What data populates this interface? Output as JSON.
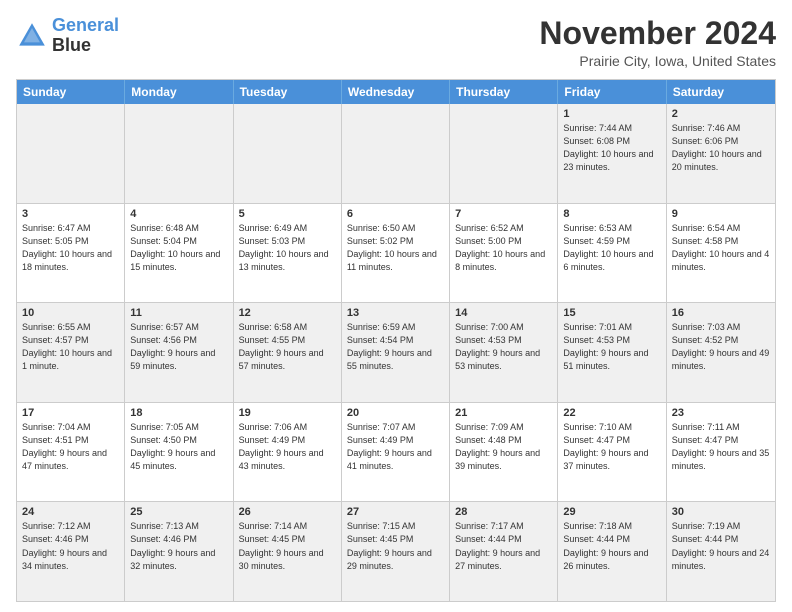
{
  "logo": {
    "line1": "General",
    "line2": "Blue"
  },
  "title": "November 2024",
  "subtitle": "Prairie City, Iowa, United States",
  "days": [
    "Sunday",
    "Monday",
    "Tuesday",
    "Wednesday",
    "Thursday",
    "Friday",
    "Saturday"
  ],
  "rows": [
    [
      {
        "day": "",
        "info": ""
      },
      {
        "day": "",
        "info": ""
      },
      {
        "day": "",
        "info": ""
      },
      {
        "day": "",
        "info": ""
      },
      {
        "day": "",
        "info": ""
      },
      {
        "day": "1",
        "info": "Sunrise: 7:44 AM\nSunset: 6:08 PM\nDaylight: 10 hours and 23 minutes."
      },
      {
        "day": "2",
        "info": "Sunrise: 7:46 AM\nSunset: 6:06 PM\nDaylight: 10 hours and 20 minutes."
      }
    ],
    [
      {
        "day": "3",
        "info": "Sunrise: 6:47 AM\nSunset: 5:05 PM\nDaylight: 10 hours and 18 minutes."
      },
      {
        "day": "4",
        "info": "Sunrise: 6:48 AM\nSunset: 5:04 PM\nDaylight: 10 hours and 15 minutes."
      },
      {
        "day": "5",
        "info": "Sunrise: 6:49 AM\nSunset: 5:03 PM\nDaylight: 10 hours and 13 minutes."
      },
      {
        "day": "6",
        "info": "Sunrise: 6:50 AM\nSunset: 5:02 PM\nDaylight: 10 hours and 11 minutes."
      },
      {
        "day": "7",
        "info": "Sunrise: 6:52 AM\nSunset: 5:00 PM\nDaylight: 10 hours and 8 minutes."
      },
      {
        "day": "8",
        "info": "Sunrise: 6:53 AM\nSunset: 4:59 PM\nDaylight: 10 hours and 6 minutes."
      },
      {
        "day": "9",
        "info": "Sunrise: 6:54 AM\nSunset: 4:58 PM\nDaylight: 10 hours and 4 minutes."
      }
    ],
    [
      {
        "day": "10",
        "info": "Sunrise: 6:55 AM\nSunset: 4:57 PM\nDaylight: 10 hours and 1 minute."
      },
      {
        "day": "11",
        "info": "Sunrise: 6:57 AM\nSunset: 4:56 PM\nDaylight: 9 hours and 59 minutes."
      },
      {
        "day": "12",
        "info": "Sunrise: 6:58 AM\nSunset: 4:55 PM\nDaylight: 9 hours and 57 minutes."
      },
      {
        "day": "13",
        "info": "Sunrise: 6:59 AM\nSunset: 4:54 PM\nDaylight: 9 hours and 55 minutes."
      },
      {
        "day": "14",
        "info": "Sunrise: 7:00 AM\nSunset: 4:53 PM\nDaylight: 9 hours and 53 minutes."
      },
      {
        "day": "15",
        "info": "Sunrise: 7:01 AM\nSunset: 4:53 PM\nDaylight: 9 hours and 51 minutes."
      },
      {
        "day": "16",
        "info": "Sunrise: 7:03 AM\nSunset: 4:52 PM\nDaylight: 9 hours and 49 minutes."
      }
    ],
    [
      {
        "day": "17",
        "info": "Sunrise: 7:04 AM\nSunset: 4:51 PM\nDaylight: 9 hours and 47 minutes."
      },
      {
        "day": "18",
        "info": "Sunrise: 7:05 AM\nSunset: 4:50 PM\nDaylight: 9 hours and 45 minutes."
      },
      {
        "day": "19",
        "info": "Sunrise: 7:06 AM\nSunset: 4:49 PM\nDaylight: 9 hours and 43 minutes."
      },
      {
        "day": "20",
        "info": "Sunrise: 7:07 AM\nSunset: 4:49 PM\nDaylight: 9 hours and 41 minutes."
      },
      {
        "day": "21",
        "info": "Sunrise: 7:09 AM\nSunset: 4:48 PM\nDaylight: 9 hours and 39 minutes."
      },
      {
        "day": "22",
        "info": "Sunrise: 7:10 AM\nSunset: 4:47 PM\nDaylight: 9 hours and 37 minutes."
      },
      {
        "day": "23",
        "info": "Sunrise: 7:11 AM\nSunset: 4:47 PM\nDaylight: 9 hours and 35 minutes."
      }
    ],
    [
      {
        "day": "24",
        "info": "Sunrise: 7:12 AM\nSunset: 4:46 PM\nDaylight: 9 hours and 34 minutes."
      },
      {
        "day": "25",
        "info": "Sunrise: 7:13 AM\nSunset: 4:46 PM\nDaylight: 9 hours and 32 minutes."
      },
      {
        "day": "26",
        "info": "Sunrise: 7:14 AM\nSunset: 4:45 PM\nDaylight: 9 hours and 30 minutes."
      },
      {
        "day": "27",
        "info": "Sunrise: 7:15 AM\nSunset: 4:45 PM\nDaylight: 9 hours and 29 minutes."
      },
      {
        "day": "28",
        "info": "Sunrise: 7:17 AM\nSunset: 4:44 PM\nDaylight: 9 hours and 27 minutes."
      },
      {
        "day": "29",
        "info": "Sunrise: 7:18 AM\nSunset: 4:44 PM\nDaylight: 9 hours and 26 minutes."
      },
      {
        "day": "30",
        "info": "Sunrise: 7:19 AM\nSunset: 4:44 PM\nDaylight: 9 hours and 24 minutes."
      }
    ]
  ]
}
